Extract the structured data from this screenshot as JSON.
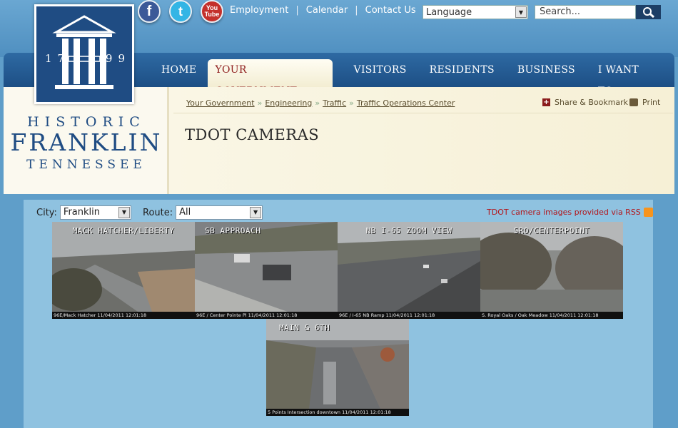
{
  "social": {
    "facebook_label": "f",
    "twitter_label": "t",
    "youtube_top": "You",
    "youtube_bottom": "Tube"
  },
  "toplinks": [
    "Employment",
    "Calendar",
    "Contact Us"
  ],
  "language": {
    "label": "Language"
  },
  "search": {
    "placeholder": "Search..."
  },
  "logo": {
    "year_left": "17",
    "year_right": "99"
  },
  "brand": {
    "line1": "HISTORIC",
    "line2": "FRANKLIN",
    "line3": "TENNESSEE"
  },
  "nav": {
    "items": [
      {
        "label": "HOME",
        "active": false
      },
      {
        "label": "YOUR GOVERNMENT",
        "active": true
      },
      {
        "label": "VISITORS",
        "active": false
      },
      {
        "label": "RESIDENTS",
        "active": false
      },
      {
        "label": "BUSINESS",
        "active": false
      },
      {
        "label": "I WANT TO...",
        "active": false
      }
    ]
  },
  "breadcrumb": [
    "Your Government",
    "Engineering",
    "Traffic",
    "Traffic Operations Center"
  ],
  "actions": {
    "share": "Share & Bookmark",
    "print": "Print"
  },
  "page_title": "TDOT CAMERAS",
  "filters": {
    "city_label": "City:",
    "city_value": "Franklin",
    "route_label": "Route:",
    "route_value": "All"
  },
  "rss_text": "TDOT camera images provided via RSS",
  "cameras": [
    {
      "caption": "MACK HATCHER/LIBERTY",
      "footer": "96E/Mack Hatcher 11/04/2011 12:01:18"
    },
    {
      "caption": "SB APPROACH",
      "footer": "96E / Center Pointe Pl 11/04/2011 12:01:18"
    },
    {
      "caption": "NB I-65 ZOOM VIEW",
      "footer": "96E / I-65 NB Ramp 11/04/2011 12:01:18"
    },
    {
      "caption": "SRO/CENTERPOINT",
      "footer": "S. Royal Oaks / Oak Meadow 11/04/2011 12:01:18"
    },
    {
      "caption": "MAIN & 6TH",
      "footer": "5 Points Intersection downtown 11/04/2011 12:01:18"
    }
  ],
  "colors": {
    "brand_blue": "#1f4c83",
    "accent_red": "#8e1b1b",
    "panel_cream": "#fbf8ea"
  }
}
